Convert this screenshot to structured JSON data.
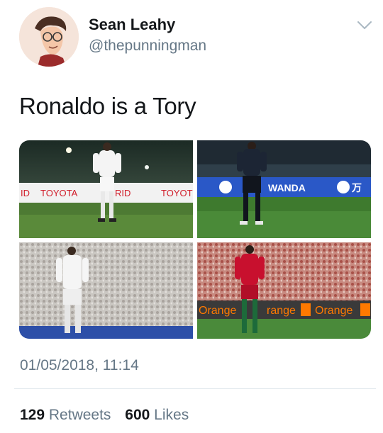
{
  "author": {
    "name": "Sean Leahy",
    "handle": "@thepunningman",
    "avatar_icon": "cartoon-face-avatar"
  },
  "menu_icon": "chevron-down-icon",
  "tweet": {
    "text": "Ronaldo is a Tory",
    "timestamp": "01/05/2018, 11:14"
  },
  "media": {
    "photo1": {
      "board_left": "ID",
      "board_mid": "TOYOTA",
      "board_right": "RID",
      "board_far": "TOYOT"
    },
    "photo2": {
      "board_text": "WANDA",
      "board_right": "万"
    },
    "photo4": {
      "board_1": "Orange",
      "board_2": "range",
      "board_3": "Orange"
    }
  },
  "stats": {
    "retweets_count": "129",
    "retweets_label": "Retweets",
    "likes_count": "600",
    "likes_label": "Likes"
  },
  "colors": {
    "text_primary": "#14171a",
    "text_secondary": "#657786",
    "divider": "#e1e8ed",
    "orange": "#ff7900"
  }
}
